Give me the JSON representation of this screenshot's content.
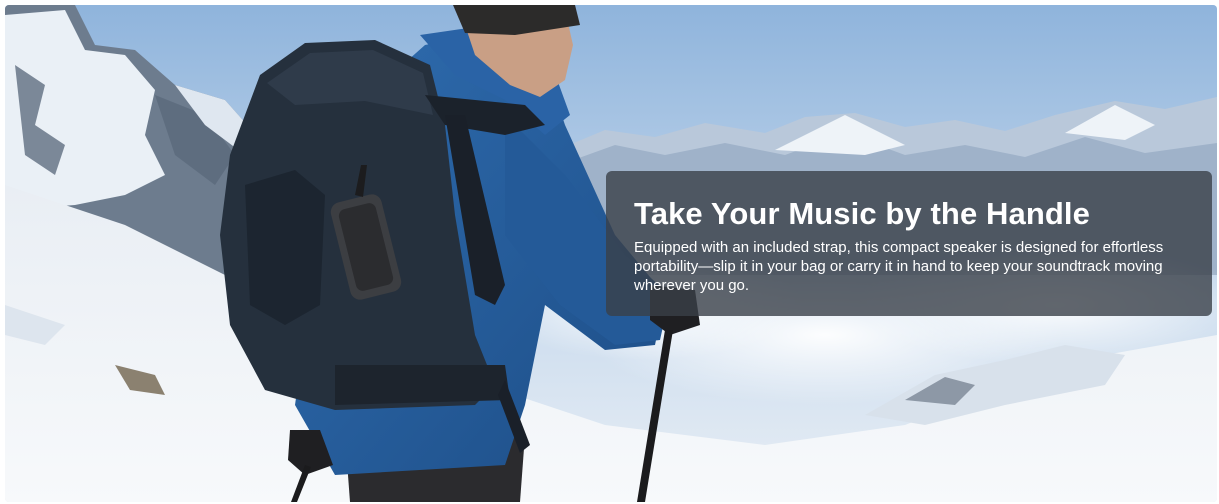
{
  "banner": {
    "title": "Take Your Music by the Handle",
    "description": "Equipped with an included strap, this compact speaker is designed for effortless portability—slip it in your bag or carry it in hand to keep your soundtrack moving wherever you go."
  }
}
